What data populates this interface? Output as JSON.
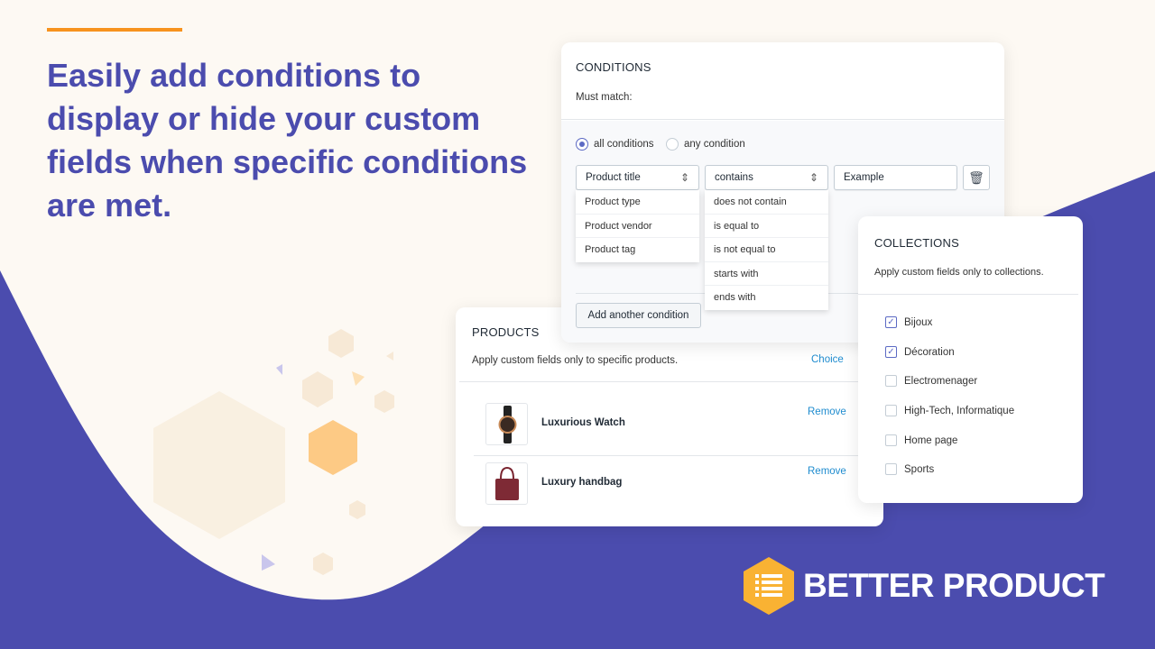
{
  "headline": "Easily add conditions to display or hide your custom fields when specific conditions are met.",
  "colors": {
    "accent": "#f7931e",
    "purple": "#4b4cae",
    "cream": "#fdf9f3",
    "link": "#1f8ccf",
    "hexagon": "#f9b233"
  },
  "conditions": {
    "title": "CONDITIONS",
    "must_match": "Must match:",
    "radios": [
      {
        "label": "all conditions",
        "selected": true
      },
      {
        "label": "any condition",
        "selected": false
      }
    ],
    "field_select": "Product title",
    "operator_select": "contains",
    "value": "Example",
    "field_options": [
      "Product type",
      "Product vendor",
      "Product tag"
    ],
    "operator_options": [
      "does not contain",
      "is equal to",
      "is not equal to",
      "starts with",
      "ends with"
    ],
    "add_button": "Add another condition",
    "delete_icon": "trash-icon"
  },
  "products": {
    "title": "PRODUCTS",
    "subtitle": "Apply custom fields only to specific products.",
    "choice": "Choice",
    "items": [
      {
        "name": "Luxurious Watch",
        "remove": "Remove"
      },
      {
        "name": "Luxury handbag",
        "remove": "Remove"
      }
    ]
  },
  "collections": {
    "title": "COLLECTIONS",
    "subtitle": "Apply custom fields only to collections.",
    "items": [
      {
        "label": "Bijoux",
        "checked": true
      },
      {
        "label": "Décoration",
        "checked": true
      },
      {
        "label": "Electromenager",
        "checked": false
      },
      {
        "label": "High-Tech, Informatique",
        "checked": false
      },
      {
        "label": "Home page",
        "checked": false
      },
      {
        "label": "Sports",
        "checked": false
      }
    ]
  },
  "brand": {
    "name": "BETTER PRODUCT",
    "icon": "list-hexagon-icon"
  }
}
